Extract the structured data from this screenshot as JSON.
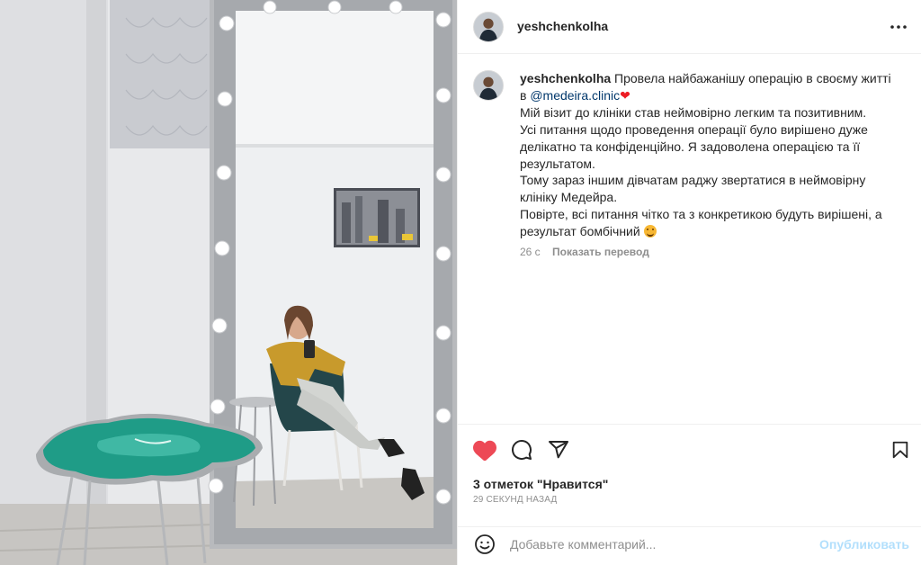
{
  "post": {
    "username": "yeshchenkolha",
    "caption": {
      "username": "yeshchenkolha",
      "line1": "Провела найбажанішу операцію в своєму житті в",
      "mention": "@medeira.clinic",
      "heart": "❤",
      "line2": "Мій візит до клініки став неймовірно легким та позитивним.",
      "line3": "Усі питання щодо проведення операції було вирішено дуже делікатно та конфіденційно. Я задоволена операцією та її результатом.",
      "line4": "Тому зараз іншим дівчатам раджу звертатися в неймовірну клініку Медейра.",
      "line5": "Повірте, всі питання чітко та з конкретикою будуть вирішені, а результат бомбічний"
    },
    "caption_age": "26 с",
    "translate_label": "Показать перевод",
    "likes_text": "3 отметок \"Нравится\"",
    "posted_time": "29 секунд назад"
  },
  "comment": {
    "placeholder": "Добавьте комментарий...",
    "post_label": "Опубликовать"
  },
  "icons": {
    "more": "more-horizontal-icon",
    "like": "heart-filled-icon",
    "comment": "comment-icon",
    "share": "send-icon",
    "save": "bookmark-icon",
    "emoji": "smile-icon"
  },
  "colors": {
    "like": "#ed4956",
    "mention": "#00376b",
    "post_disabled": "#b2dffc",
    "secondary_text": "#8e8e8e"
  }
}
